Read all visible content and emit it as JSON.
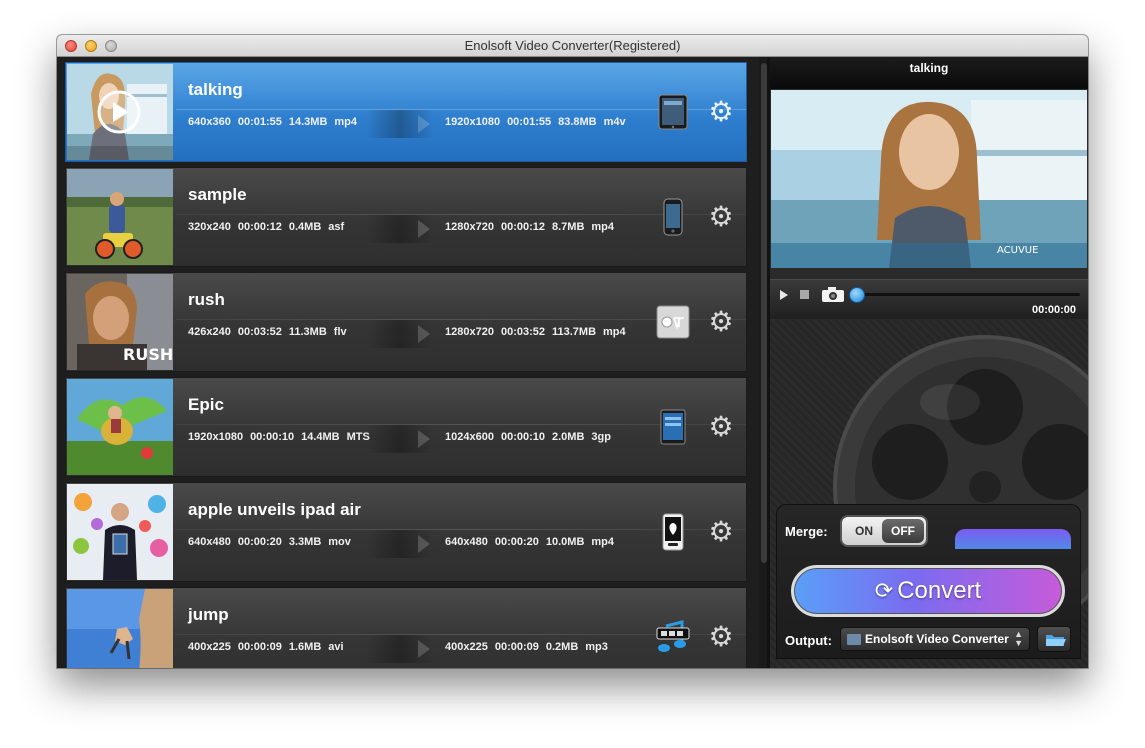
{
  "window": {
    "title": "Enolsoft Video Converter(Registered)"
  },
  "files": [
    {
      "name": "talking",
      "selected": true,
      "source": {
        "resolution": "640x360",
        "duration": "00:01:55",
        "size": "14.3MB",
        "format": "mp4"
      },
      "output": {
        "resolution": "1920x1080",
        "duration": "00:01:55",
        "size": "83.8MB",
        "format": "m4v"
      },
      "device_icon": "ipad-icon"
    },
    {
      "name": "sample",
      "selected": false,
      "source": {
        "resolution": "320x240",
        "duration": "00:00:12",
        "size": "0.4MB",
        "format": "asf"
      },
      "output": {
        "resolution": "1280x720",
        "duration": "00:00:12",
        "size": "8.7MB",
        "format": "mp4"
      },
      "device_icon": "iphone-icon"
    },
    {
      "name": "rush",
      "selected": false,
      "source": {
        "resolution": "426x240",
        "duration": "00:03:52",
        "size": "11.3MB",
        "format": "flv"
      },
      "output": {
        "resolution": "1280x720",
        "duration": "00:03:52",
        "size": "113.7MB",
        "format": "mp4"
      },
      "device_icon": "apple-tv-icon"
    },
    {
      "name": "Epic",
      "selected": false,
      "source": {
        "resolution": "1920x1080",
        "duration": "00:00:10",
        "size": "14.4MB",
        "format": "MTS"
      },
      "output": {
        "resolution": "1024x600",
        "duration": "00:00:10",
        "size": "2.0MB",
        "format": "3gp"
      },
      "device_icon": "tablet-icon"
    },
    {
      "name": "apple unveils ipad air",
      "selected": false,
      "source": {
        "resolution": "640x480",
        "duration": "00:00:20",
        "size": "3.3MB",
        "format": "mov"
      },
      "output": {
        "resolution": "640x480",
        "duration": "00:00:20",
        "size": "10.0MB",
        "format": "mp4"
      },
      "device_icon": "ipod-icon"
    },
    {
      "name": "jump",
      "selected": false,
      "source": {
        "resolution": "400x225",
        "duration": "00:00:09",
        "size": "1.6MB",
        "format": "avi"
      },
      "output": {
        "resolution": "400x225",
        "duration": "00:00:09",
        "size": "0.2MB",
        "format": "mp3"
      },
      "device_icon": "mp3-icon"
    }
  ],
  "thumb_labels": {
    "rush": "RUSH"
  },
  "preview": {
    "title": "talking",
    "overlay_brand": "ACUVUE",
    "time": "00:00:00",
    "progress": 0
  },
  "merge": {
    "label": "Merge:",
    "on_label": "ON",
    "off_label": "OFF",
    "state": "off"
  },
  "convert": {
    "label": "Convert"
  },
  "output": {
    "label": "Output:",
    "selected": "Enolsoft Video Converter",
    "arrows": "▲▼"
  },
  "colors": {
    "selection": "#2f7fcf",
    "accent_blue": "#1a86d6",
    "convert_start": "#5a9ff7",
    "convert_end": "#c75bd9"
  }
}
